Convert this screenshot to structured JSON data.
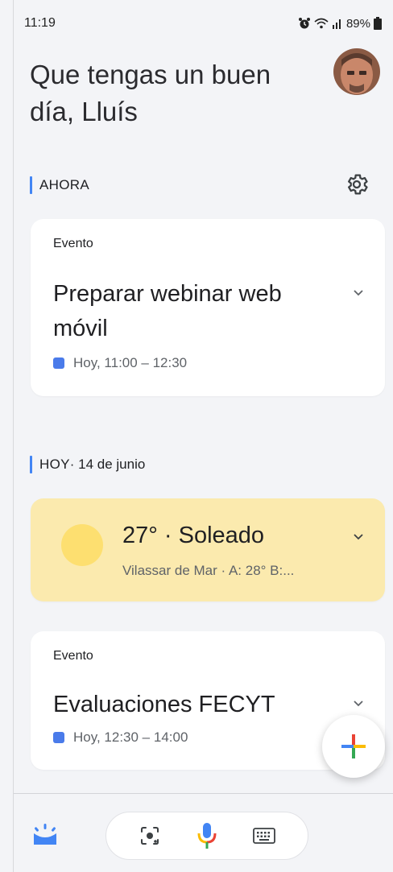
{
  "status": {
    "time": "11:19",
    "battery": "89%"
  },
  "greeting": "Que tengas un buen día, Lluís",
  "sections": {
    "now": {
      "label": "AHORA"
    },
    "today": {
      "label": "HOY",
      "date": " · 14 de junio"
    }
  },
  "cards": [
    {
      "kind": "Evento",
      "title": "Preparar webinar web móvil",
      "when": "Hoy, 11:00 – 12:30",
      "color": "#4a7bea"
    },
    {
      "kind": "Evento",
      "title": "Evaluaciones FECYT",
      "when": "Hoy, 12:30 – 14:00",
      "color": "#4a7bea"
    }
  ],
  "weather": {
    "headline": "27° · Soleado",
    "detail": "Vilassar de Mar · A: 28° B:..."
  },
  "colors": {
    "accent": "#4285f4",
    "weather_bg": "#fbeaae",
    "sun": "#fddf70"
  },
  "icons": {
    "settings": "gear-icon",
    "home": "home-sparkle-icon",
    "lens": "lens-icon",
    "mic": "microphone-icon",
    "keyboard": "keyboard-icon",
    "add": "plus-icon"
  }
}
